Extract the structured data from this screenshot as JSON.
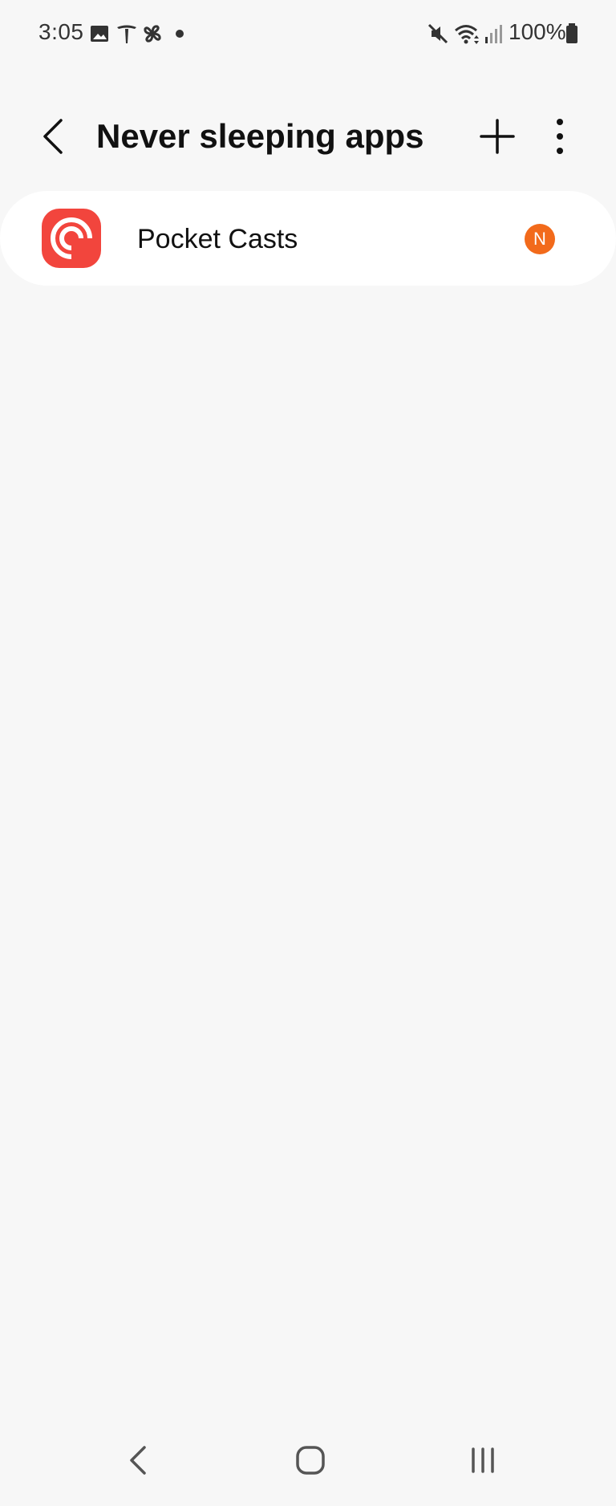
{
  "status_bar": {
    "time": "3:05",
    "battery": "100%",
    "icons_left": [
      "gallery-icon",
      "tesla-icon",
      "pinwheel-icon",
      "dot-icon"
    ],
    "icons_right": [
      "mute-icon",
      "wifi-icon",
      "signal-icon",
      "battery-icon"
    ]
  },
  "header": {
    "title": "Never sleeping apps",
    "back_icon": "back-chevron-icon",
    "add_icon": "plus-icon",
    "more_icon": "more-vertical-icon"
  },
  "apps": [
    {
      "name": "Pocket Casts",
      "icon": "pocket-casts-icon",
      "badge": "N"
    }
  ],
  "colors": {
    "background": "#f7f7f7",
    "card": "#ffffff",
    "pocket_casts_red": "#f2453d",
    "badge_orange": "#f26a1b"
  },
  "nav_bar": {
    "back_icon": "nav-back-icon",
    "home_icon": "nav-home-icon",
    "recents_icon": "nav-recents-icon"
  }
}
